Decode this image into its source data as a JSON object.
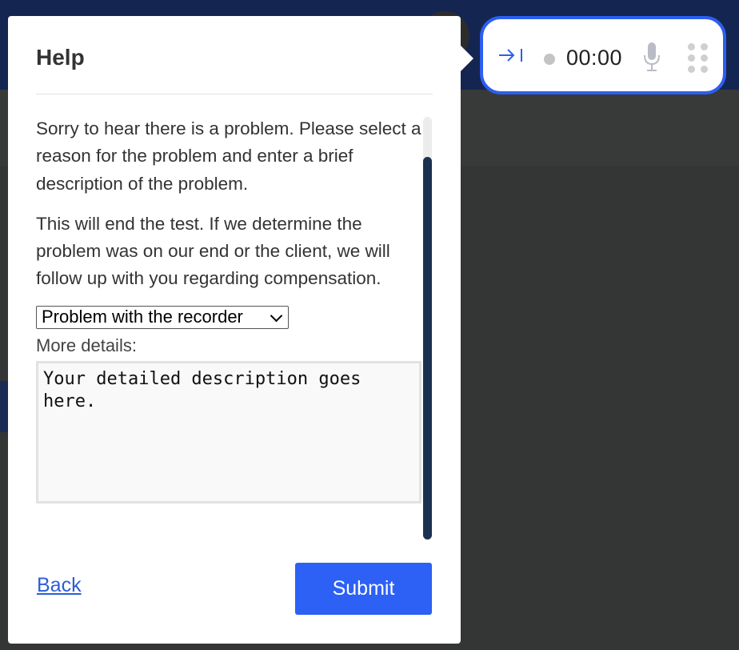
{
  "help": {
    "title": "Help",
    "paragraphs": [
      "Sorry to hear there is a problem.  Please select a reason for the problem and enter a brief description of the problem.",
      "This will end the test. If we determine the problem was on our end or the client, we will follow up with you regarding compensation."
    ],
    "reason_select": {
      "value": "Problem with the recorder"
    },
    "details_label": "More details:",
    "details_value": "Your detailed description goes here.",
    "back_label": "Back",
    "submit_label": "Submit"
  },
  "recorder": {
    "timer": "00:00",
    "icons": {
      "collapse": "collapse-arrow-icon",
      "record": "record-dot-icon",
      "mic": "microphone-icon",
      "drag": "drag-handle-icon"
    }
  },
  "colors": {
    "accent_blue": "#2d60f4",
    "scroll_thumb": "#1c3152",
    "top_bar": "#142552"
  }
}
